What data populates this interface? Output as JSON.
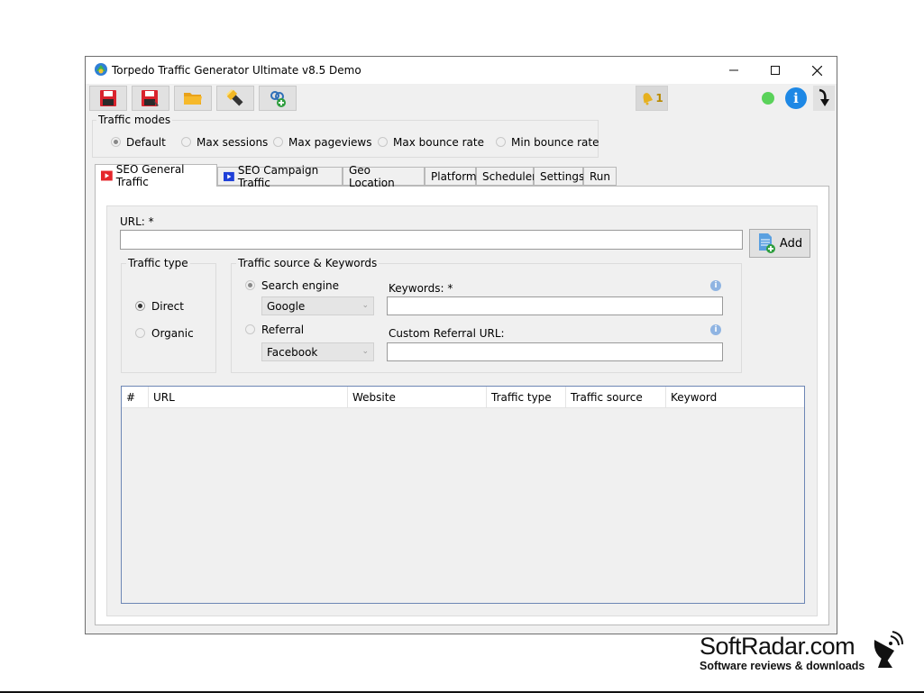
{
  "window": {
    "title": "Torpedo Traffic Generator Ultimate v8.5 Demo"
  },
  "toolbar": {
    "notification_count": "1",
    "icons": [
      "save-icon",
      "save-as-icon",
      "open-folder-icon",
      "flashlight-icon",
      "link-add-icon",
      "bell-icon",
      "status-dot-icon",
      "info-icon",
      "arrow-down-icon"
    ]
  },
  "traffic_modes": {
    "label": "Traffic modes",
    "options": [
      "Default",
      "Max sessions",
      "Max pageviews",
      "Max bounce rate",
      "Min bounce rate"
    ],
    "selected": "Default"
  },
  "tabs": [
    "SEO General Traffic",
    "SEO Campaign Traffic",
    "Geo Location",
    "Platform",
    "Scheduler",
    "Settings",
    "Run"
  ],
  "url_field": {
    "label": "URL: *",
    "value": ""
  },
  "add_button": {
    "label": "Add"
  },
  "traffic_type": {
    "label": "Traffic type",
    "options": [
      "Direct",
      "Organic"
    ],
    "selected": "Direct"
  },
  "traffic_source": {
    "label": "Traffic source & Keywords",
    "search_engine_label": "Search engine",
    "search_engine_value": "Google",
    "referral_label": "Referral",
    "referral_value": "Facebook",
    "keywords_label": "Keywords: *",
    "custom_referral_label": "Custom Referral URL:"
  },
  "table": {
    "columns": [
      "#",
      "URL",
      "Website",
      "Traffic type",
      "Traffic source",
      "Keyword"
    ],
    "rows": []
  },
  "watermark": {
    "brand": "SoftRadar.com",
    "tagline": "Software reviews & downloads"
  },
  "colors": {
    "status_green": "#5ad25a",
    "info_blue": "#1e88e5",
    "folder_yellow": "#f6b92b",
    "save_red": "#d9232d"
  }
}
